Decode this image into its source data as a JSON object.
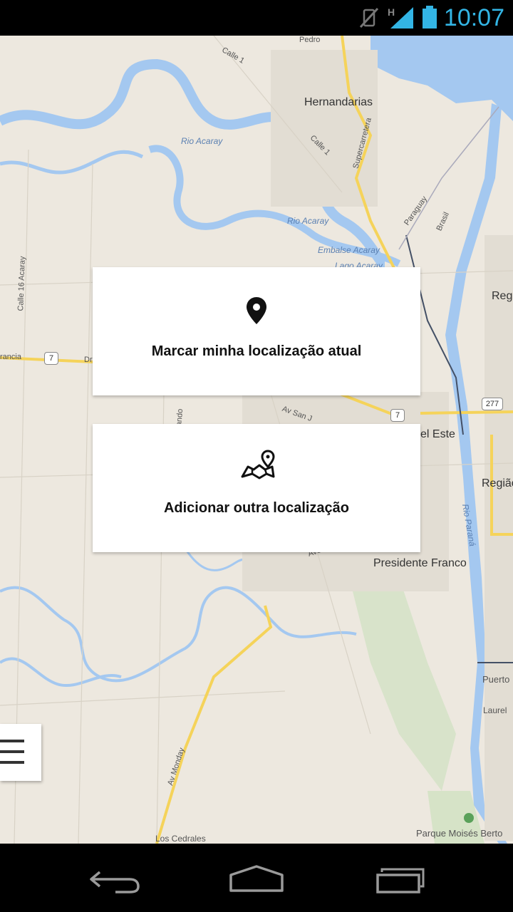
{
  "status_bar": {
    "time": "10:07",
    "icons": [
      "vibrate-icon",
      "signal-h-icon",
      "battery-icon"
    ],
    "accent_color": "#33b5e5"
  },
  "map": {
    "places": {
      "hernandarias": "Hernandarias",
      "presidente_franco": "Presidente Franco",
      "del_este": "el Este",
      "regiao_1": "Regiã",
      "regiao_2": "Região",
      "puerto": "Puerto",
      "laurel": "Laurel",
      "parque": "Parque Moisés Berto",
      "los_cedrales": "Los Cedrales"
    },
    "water": {
      "rio_acaray_1": "Rio Acaray",
      "rio_acaray_2": "Rio Acaray",
      "embalse": "Embalse Acaray",
      "lago": "Lago Acaray",
      "rio_parana": "Rio Paraná"
    },
    "roads": {
      "calle_1a": "Calle 1",
      "calle_1b": "Calle 1",
      "supercarretera": "Supercarretera",
      "paraguay": "Paraguay",
      "brasil": "Brasil",
      "calle_16": "Calle 16 Acaray",
      "ancia": "rancia",
      "dr": "Dr",
      "av_san": "Av San J",
      "av_monday": "Av Monday",
      "ave": "Ave",
      "ando": "ando",
      "pedro": "Pedro"
    },
    "shields": {
      "route_7a": "7",
      "route_7b": "7",
      "route_277": "277"
    }
  },
  "cards": {
    "current_location": {
      "label": "Marcar minha localização atual",
      "icon": "map-pin-icon"
    },
    "other_location": {
      "label": "Adicionar outra localização",
      "icon": "folded-map-pin-icon"
    }
  },
  "menu": {
    "icon": "hamburger-menu-icon"
  },
  "nav_bar": {
    "icons": [
      "back-icon",
      "home-icon",
      "recent-apps-icon"
    ]
  }
}
